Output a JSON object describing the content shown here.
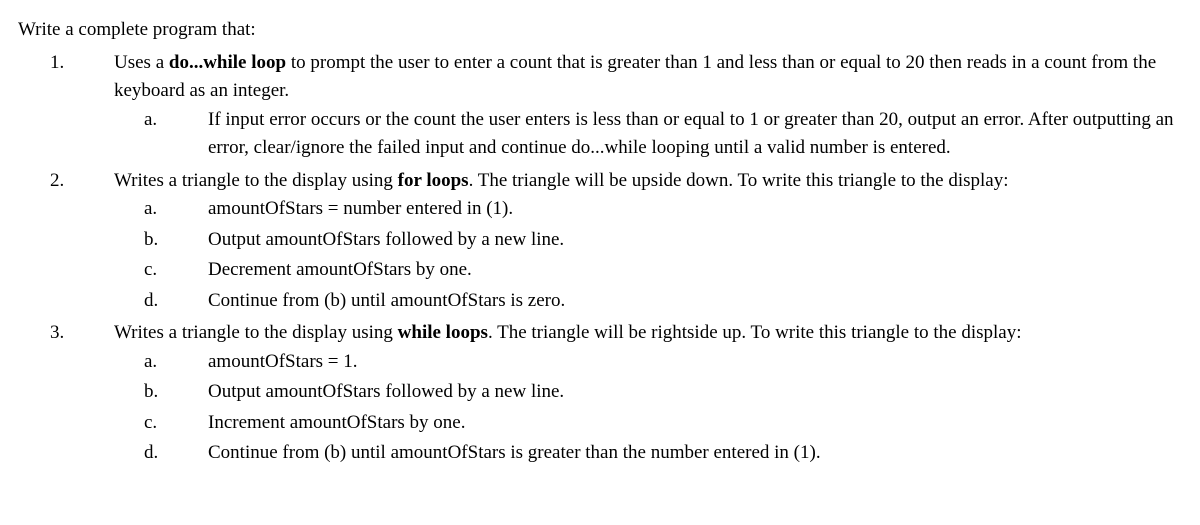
{
  "intro": "Write a complete program that:",
  "items": [
    {
      "num": "1.",
      "text_pre": "Uses a ",
      "text_bold": "do...while loop",
      "text_post": " to prompt the user to enter a count that is greater than 1 and less than or equal to 20 then reads in a count from the keyboard as an integer.",
      "sub": [
        {
          "letter": "a.",
          "text": "If input error occurs or the count the user enters is less than or equal to 1 or greater than 20, output an error. After outputting an error, clear/ignore the failed input and continue do...while looping until a valid number is entered."
        }
      ]
    },
    {
      "num": "2.",
      "text_pre": "Writes a triangle to the display using ",
      "text_bold": "for loops",
      "text_post": ". The triangle will be upside down. To write this triangle to the display:",
      "sub": [
        {
          "letter": "a.",
          "text": "amountOfStars = number entered in (1)."
        },
        {
          "letter": "b.",
          "text": "Output amountOfStars followed by a new line."
        },
        {
          "letter": "c.",
          "text": "Decrement amountOfStars by one."
        },
        {
          "letter": "d.",
          "text": "Continue from (b) until amountOfStars is zero."
        }
      ]
    },
    {
      "num": "3.",
      "text_pre": "Writes a triangle to the display using ",
      "text_bold": "while loops",
      "text_post": ". The triangle will be rightside up. To write this triangle to the display:",
      "sub": [
        {
          "letter": "a.",
          "text": "amountOfStars = 1."
        },
        {
          "letter": "b.",
          "text": "Output amountOfStars followed by a new line."
        },
        {
          "letter": "c.",
          "text": "Increment amountOfStars by one."
        },
        {
          "letter": "d.",
          "text": "Continue from (b) until amountOfStars is greater than the number entered in (1)."
        }
      ]
    }
  ]
}
